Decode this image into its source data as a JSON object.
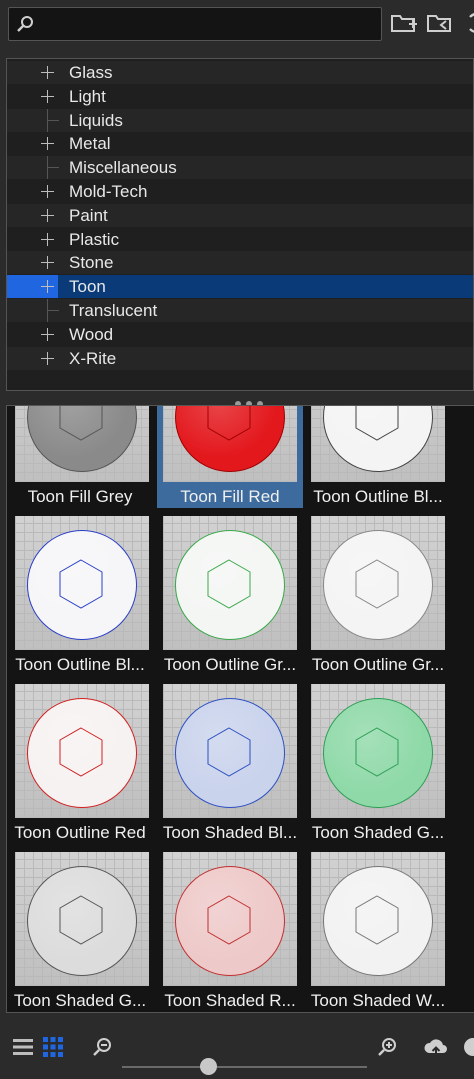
{
  "search": {
    "value": "",
    "placeholder": ""
  },
  "toolbar": {
    "icons": [
      "search-icon",
      "new-folder-icon",
      "import-folder-icon",
      "refresh-icon"
    ]
  },
  "tree": {
    "selected": "Toon",
    "items": [
      {
        "label": "Glass",
        "expandable": true
      },
      {
        "label": "Light",
        "expandable": true
      },
      {
        "label": "Liquids",
        "expandable": false
      },
      {
        "label": "Metal",
        "expandable": true
      },
      {
        "label": "Miscellaneous",
        "expandable": false
      },
      {
        "label": "Mold-Tech",
        "expandable": true
      },
      {
        "label": "Paint",
        "expandable": true
      },
      {
        "label": "Plastic",
        "expandable": true
      },
      {
        "label": "Stone",
        "expandable": true
      },
      {
        "label": "Toon",
        "expandable": true
      },
      {
        "label": "Translucent",
        "expandable": false
      },
      {
        "label": "Wood",
        "expandable": true
      },
      {
        "label": "X-Rite",
        "expandable": true
      }
    ]
  },
  "materials": {
    "selected": "Toon Fill Red",
    "items": [
      {
        "label": "Toon Fill Grey",
        "fill": "#8a8a8a",
        "outline": "#555555"
      },
      {
        "label": "Toon Fill Red",
        "fill": "#e3181d",
        "outline": "#a00000"
      },
      {
        "label": "Toon Outline Bl...",
        "fill": "#f4f4f4",
        "outline": "#444444"
      },
      {
        "label": "Toon Outline Bl...",
        "fill": "#f6f6f8",
        "outline": "#2a3fc8"
      },
      {
        "label": "Toon Outline Gr...",
        "fill": "#f4f6f4",
        "outline": "#3aa84a"
      },
      {
        "label": "Toon Outline Gr...",
        "fill": "#f4f4f4",
        "outline": "#888888"
      },
      {
        "label": "Toon Outline Red",
        "fill": "#f7f2f2",
        "outline": "#d02020"
      },
      {
        "label": "Toon Shaded Bl...",
        "fill": "#c9d3ec",
        "outline": "#2d4fc0"
      },
      {
        "label": "Toon Shaded G...",
        "fill": "#8fd9a8",
        "outline": "#2e9e55"
      },
      {
        "label": "Toon Shaded G...",
        "fill": "#dcdcdc",
        "outline": "#555555"
      },
      {
        "label": "Toon Shaded R...",
        "fill": "#eec9c9",
        "outline": "#c03030"
      },
      {
        "label": "Toon Shaded W...",
        "fill": "#f2f2f2",
        "outline": "#777777"
      }
    ]
  },
  "bottombar": {
    "view_modes": [
      "list-view-icon",
      "grid-view-icon"
    ],
    "active_view": "grid",
    "zoom": 0.35,
    "accent": "#1f66e0"
  }
}
